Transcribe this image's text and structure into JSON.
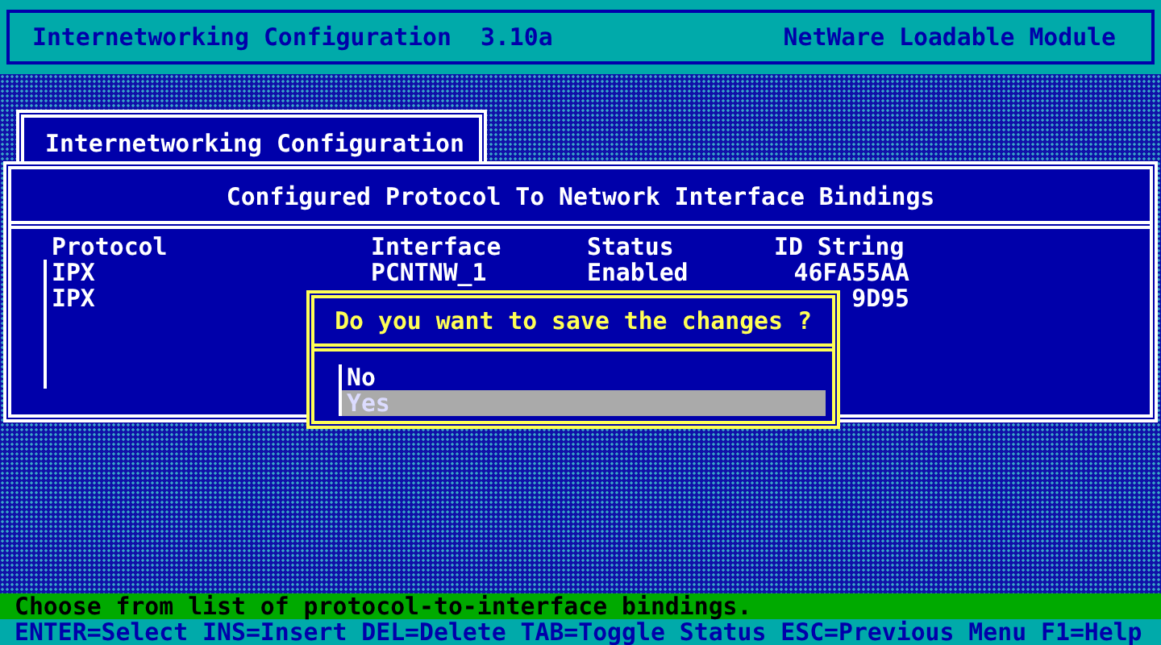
{
  "header": {
    "title": "Internetworking Configuration",
    "version": "3.10a",
    "module": "NetWare Loadable Module"
  },
  "menu_title": "Internetworking Configuration",
  "bindings": {
    "title": "Configured Protocol To Network Interface Bindings",
    "columns": [
      "Protocol",
      "Interface",
      "Status",
      "ID String"
    ],
    "rows": [
      {
        "protocol": "IPX",
        "interface": "PCNTNW_1",
        "status": "Enabled",
        "id_string": "46FA55AA"
      },
      {
        "protocol": "IPX",
        "id_string": "9D95"
      }
    ]
  },
  "dialog": {
    "question": "Do you want to save the changes ?",
    "options": [
      {
        "label": "No",
        "selected": false
      },
      {
        "label": "Yes",
        "selected": true
      }
    ]
  },
  "status_bar": {
    "hint": "Choose from list of protocol-to-interface bindings.",
    "keys": "ENTER=Select INS=Insert DEL=Delete TAB=Toggle Status ESC=Previous Menu F1=Help"
  }
}
